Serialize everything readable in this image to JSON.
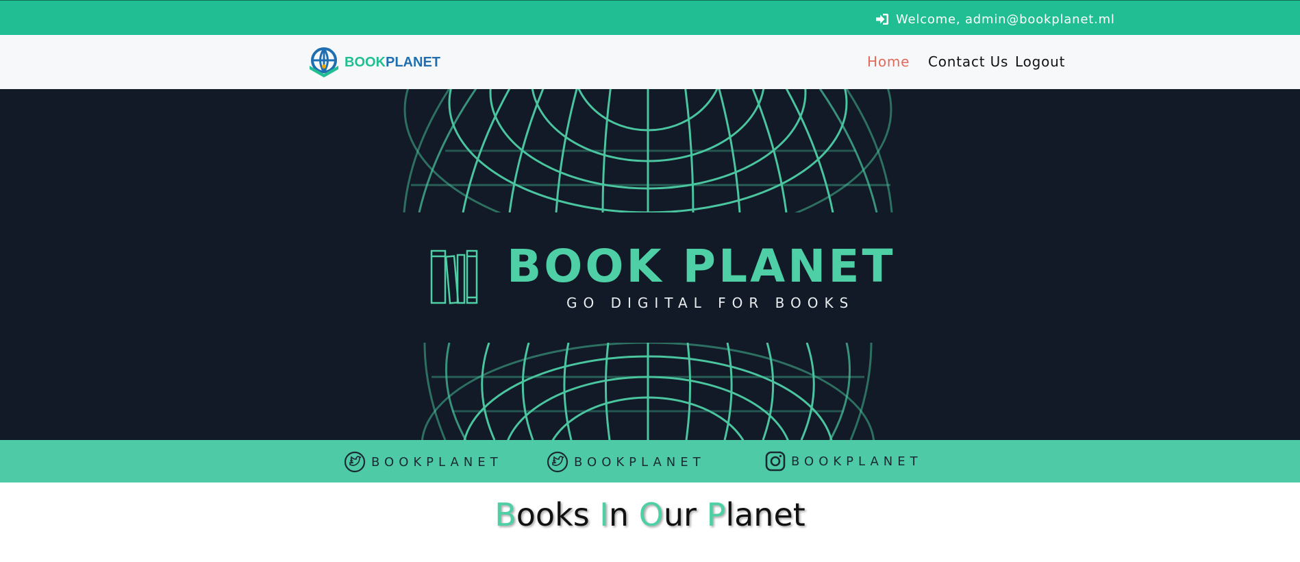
{
  "topbar": {
    "welcome_text": "Welcome, admin@bookplanet.ml",
    "icon": "sign-in-icon"
  },
  "navbar": {
    "logo_text_part1": "BOOK",
    "logo_text_part2": "PLANET",
    "links": [
      {
        "label": "Home",
        "active": true
      },
      {
        "label": "Contact Us",
        "active": false
      },
      {
        "label": "Logout",
        "active": false
      }
    ]
  },
  "hero": {
    "title": "BOOK PLANET",
    "subtitle": "GO DIGITAL FOR BOOKS",
    "accent_color": "#4ecfa6",
    "background_color": "#111a26"
  },
  "social": {
    "items": [
      {
        "icon": "twitter-icon",
        "label": "BOOKPLANET"
      },
      {
        "icon": "twitter-icon",
        "label": "BOOKPLANET"
      },
      {
        "icon": "instagram-icon",
        "label": "BOOKPLANET"
      }
    ]
  },
  "section": {
    "heading_words": [
      {
        "cap": "B",
        "rest": "ooks"
      },
      {
        "cap": "I",
        "rest": "n"
      },
      {
        "cap": "O",
        "rest": "ur"
      },
      {
        "cap": "P",
        "rest": "lanet"
      }
    ]
  },
  "colors": {
    "topbar": "#22be93",
    "nav_active": "#e36a5a",
    "social_strip": "#4ecba6"
  }
}
